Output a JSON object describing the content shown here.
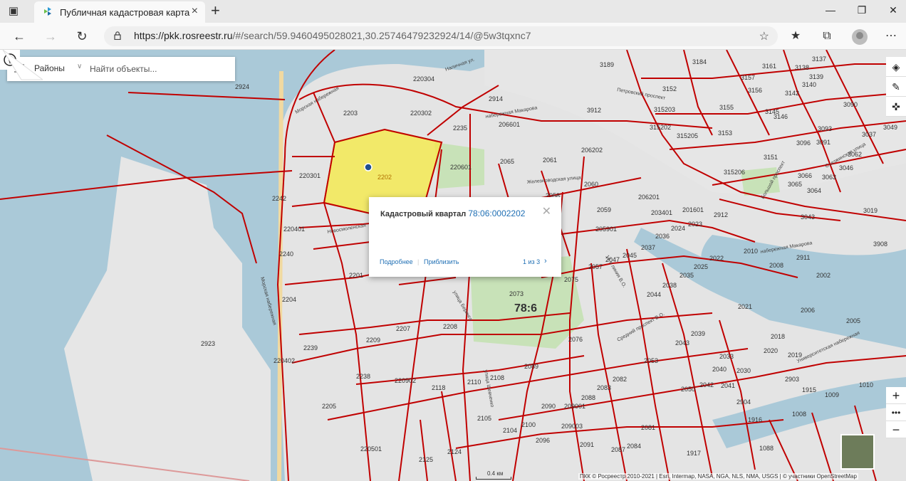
{
  "browser": {
    "tab_title": "Публичная кадастровая карта",
    "url_host": "https://pkk.rosreestr.ru",
    "url_path": "/#/search/59.9460495028021,30.25746479232924/14/@5w3tqxnc7",
    "icons": [
      "tab-actions-icon",
      "close-icon",
      "new-tab-icon",
      "minimize-icon",
      "maximize-icon",
      "window-close-icon",
      "back-icon",
      "forward-icon",
      "refresh-icon",
      "lock-icon",
      "add-favorite-icon",
      "favorites-icon",
      "collections-icon",
      "profile-icon",
      "more-icon"
    ]
  },
  "map_ui": {
    "layer_select": "Районы",
    "search_placeholder": "Найти объекты...",
    "popup": {
      "title": "Кадастровый квартал",
      "number": "78:06:0002202",
      "more": "Подробнее",
      "zoom": "Приблизить",
      "pages": "1 из 3"
    },
    "scale": "0.4 км",
    "attribution": "ПКК © Росреестр 2010-2021 | Esri, Intermap, NASA, NGA, NLS, NMA, USGS | © участники OpenStreetMap",
    "colors": {
      "parcel_border": "#c00000",
      "highlight": "#f5ea4a",
      "link": "#1f6fb4"
    }
  },
  "map_labels": [
    {
      "id": "region",
      "text": "78:6"
    },
    {
      "id": "sel",
      "text": "2202"
    },
    {
      "id": "l1",
      "text": "2203"
    },
    {
      "id": "l2",
      "text": "220302"
    },
    {
      "id": "l3",
      "text": "220304"
    },
    {
      "id": "l4",
      "text": "2914"
    },
    {
      "id": "l5",
      "text": "2235"
    },
    {
      "id": "l6",
      "text": "206601"
    },
    {
      "id": "l7",
      "text": "220601"
    },
    {
      "id": "l8",
      "text": "2065"
    },
    {
      "id": "l9",
      "text": "2061"
    },
    {
      "id": "l10",
      "text": "206202"
    },
    {
      "id": "l11",
      "text": "2060"
    },
    {
      "id": "l12",
      "text": "2058"
    },
    {
      "id": "l13",
      "text": "220301"
    },
    {
      "id": "l14",
      "text": "2242"
    },
    {
      "id": "l15",
      "text": "220401"
    },
    {
      "id": "l16",
      "text": "2240"
    },
    {
      "id": "l17",
      "text": "2201"
    },
    {
      "id": "l18",
      "text": "2204"
    },
    {
      "id": "l19",
      "text": "2239"
    },
    {
      "id": "l20",
      "text": "220402"
    },
    {
      "id": "l21",
      "text": "2923"
    },
    {
      "id": "l22",
      "text": "2209"
    },
    {
      "id": "l23",
      "text": "2207"
    },
    {
      "id": "l24",
      "text": "2208"
    },
    {
      "id": "l25",
      "text": "2073"
    },
    {
      "id": "l26",
      "text": "2076"
    },
    {
      "id": "l27",
      "text": "2075"
    },
    {
      "id": "l28",
      "text": "2089"
    },
    {
      "id": "l29",
      "text": "2238"
    },
    {
      "id": "l30",
      "text": "220902"
    },
    {
      "id": "l31",
      "text": "2205"
    },
    {
      "id": "l32",
      "text": "220501"
    },
    {
      "id": "l33",
      "text": "2125"
    },
    {
      "id": "l34",
      "text": "2108"
    },
    {
      "id": "l35",
      "text": "2110"
    },
    {
      "id": "l36",
      "text": "2118"
    },
    {
      "id": "l37",
      "text": "2090"
    },
    {
      "id": "l38",
      "text": "209001"
    },
    {
      "id": "l39",
      "text": "2088"
    },
    {
      "id": "l40",
      "text": "2083"
    },
    {
      "id": "l41",
      "text": "2082"
    },
    {
      "id": "l42",
      "text": "2081"
    },
    {
      "id": "l43",
      "text": "2084"
    },
    {
      "id": "l44",
      "text": "2087"
    },
    {
      "id": "l45",
      "text": "2091"
    },
    {
      "id": "l46",
      "text": "209003"
    },
    {
      "id": "l47",
      "text": "2096"
    },
    {
      "id": "l48",
      "text": "2100"
    },
    {
      "id": "l49",
      "text": "2104"
    },
    {
      "id": "l50",
      "text": "2105"
    },
    {
      "id": "l51",
      "text": "2124"
    },
    {
      "id": "l52",
      "text": "2059"
    },
    {
      "id": "l53",
      "text": "205901"
    },
    {
      "id": "l54",
      "text": "206201"
    },
    {
      "id": "l55",
      "text": "2036"
    },
    {
      "id": "l56",
      "text": "2037"
    },
    {
      "id": "l57",
      "text": "2045"
    },
    {
      "id": "l58",
      "text": "2047"
    },
    {
      "id": "l59",
      "text": "2057"
    },
    {
      "id": "l60",
      "text": "2044"
    },
    {
      "id": "l61",
      "text": "2038"
    },
    {
      "id": "l62",
      "text": "2035"
    },
    {
      "id": "l63",
      "text": "2025"
    },
    {
      "id": "l64",
      "text": "2024"
    },
    {
      "id": "l65",
      "text": "2023"
    },
    {
      "id": "l66",
      "text": "2022"
    },
    {
      "id": "l67",
      "text": "2021"
    },
    {
      "id": "l68",
      "text": "2039"
    },
    {
      "id": "l69",
      "text": "2043"
    },
    {
      "id": "l70",
      "text": "2053"
    },
    {
      "id": "l71",
      "text": "2050"
    },
    {
      "id": "l72",
      "text": "2042"
    },
    {
      "id": "l73",
      "text": "2041"
    },
    {
      "id": "l74",
      "text": "2040"
    },
    {
      "id": "l75",
      "text": "2033"
    },
    {
      "id": "l76",
      "text": "2030"
    },
    {
      "id": "l77",
      "text": "2020"
    },
    {
      "id": "l78",
      "text": "2019"
    },
    {
      "id": "l79",
      "text": "2018"
    },
    {
      "id": "l80",
      "text": "2006"
    },
    {
      "id": "l81",
      "text": "2005"
    },
    {
      "id": "l82",
      "text": "2002"
    },
    {
      "id": "l83",
      "text": "2008"
    },
    {
      "id": "l84",
      "text": "2010"
    },
    {
      "id": "l85",
      "text": "2911"
    },
    {
      "id": "l86",
      "text": "2912"
    },
    {
      "id": "l87",
      "text": "201601"
    },
    {
      "id": "l88",
      "text": "203401"
    },
    {
      "id": "l89",
      "text": "2903"
    },
    {
      "id": "l90",
      "text": "2904"
    },
    {
      "id": "l91",
      "text": "1915"
    },
    {
      "id": "l92",
      "text": "1917"
    },
    {
      "id": "l93",
      "text": "1916"
    },
    {
      "id": "l94",
      "text": "1088"
    },
    {
      "id": "l95",
      "text": "1008"
    },
    {
      "id": "l96",
      "text": "1009"
    },
    {
      "id": "l97",
      "text": "1010"
    },
    {
      "id": "l98",
      "text": "3189"
    },
    {
      "id": "l99",
      "text": "3912"
    },
    {
      "id": "l100",
      "text": "3152"
    },
    {
      "id": "l101",
      "text": "315203"
    },
    {
      "id": "l102",
      "text": "315202"
    },
    {
      "id": "l103",
      "text": "315205"
    },
    {
      "id": "l104",
      "text": "315206"
    },
    {
      "id": "l105",
      "text": "3153"
    },
    {
      "id": "l106",
      "text": "3155"
    },
    {
      "id": "l107",
      "text": "3156"
    },
    {
      "id": "l108",
      "text": "3157"
    },
    {
      "id": "l109",
      "text": "3161"
    },
    {
      "id": "l110",
      "text": "3184"
    },
    {
      "id": "l111",
      "text": "3137"
    },
    {
      "id": "l112",
      "text": "3138"
    },
    {
      "id": "l113",
      "text": "3139"
    },
    {
      "id": "l114",
      "text": "3140"
    },
    {
      "id": "l115",
      "text": "3142"
    },
    {
      "id": "l116",
      "text": "3145"
    },
    {
      "id": "l117",
      "text": "3146"
    },
    {
      "id": "l118",
      "text": "3091"
    },
    {
      "id": "l119",
      "text": "3093"
    },
    {
      "id": "l120",
      "text": "3096"
    },
    {
      "id": "l121",
      "text": "3151"
    },
    {
      "id": "l122",
      "text": "3066"
    },
    {
      "id": "l123",
      "text": "3063"
    },
    {
      "id": "l124",
      "text": "3064"
    },
    {
      "id": "l125",
      "text": "3065"
    },
    {
      "id": "l126",
      "text": "3043"
    },
    {
      "id": "l127",
      "text": "3046"
    },
    {
      "id": "l128",
      "text": "3049"
    },
    {
      "id": "l129",
      "text": "3062"
    },
    {
      "id": "l130",
      "text": "3019"
    },
    {
      "id": "l131",
      "text": "3037"
    },
    {
      "id": "l132",
      "text": "3090"
    },
    {
      "id": "l133",
      "text": "2924"
    },
    {
      "id": "l134",
      "text": "3908"
    }
  ],
  "map_streets": [
    {
      "id": "s1",
      "text": "Морская набережная"
    },
    {
      "id": "s2",
      "text": "Наличная ул."
    },
    {
      "id": "s3",
      "text": "набережная Макарова"
    },
    {
      "id": "s4",
      "text": "Железноводская улица"
    },
    {
      "id": "s5",
      "text": "Новосмоленская"
    },
    {
      "id": "s6",
      "text": "Морская набережная"
    },
    {
      "id": "s7",
      "text": "улица Беринга"
    },
    {
      "id": "s8",
      "text": "Средний проспект В.О."
    },
    {
      "id": "s9",
      "text": "Петровский проспект"
    },
    {
      "id": "s10",
      "text": "Большой проспект"
    },
    {
      "id": "s11",
      "text": "Съезжинская улица"
    },
    {
      "id": "s12",
      "text": "набережная Макарова"
    },
    {
      "id": "s13",
      "text": "Университетская набережная"
    },
    {
      "id": "s14",
      "text": "улица Шевченко"
    },
    {
      "id": "s15",
      "text": "14-я линия В.О."
    }
  ]
}
